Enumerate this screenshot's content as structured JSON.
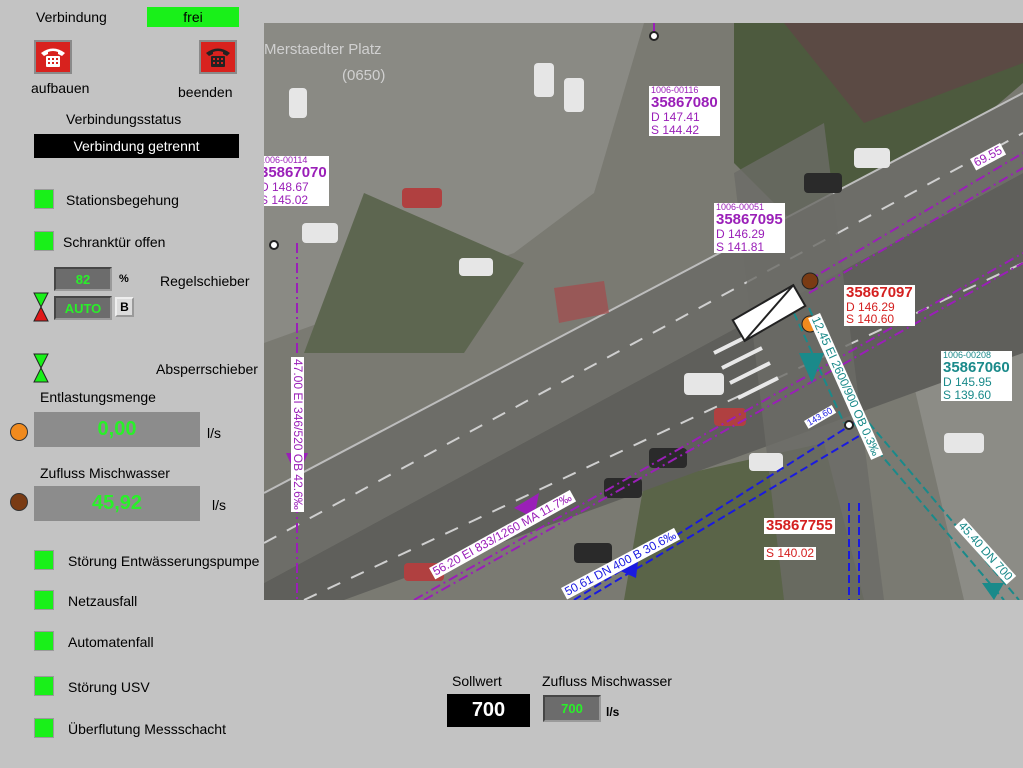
{
  "connection": {
    "label": "Verbindung",
    "state": "frei",
    "connect_label": "aufbauen",
    "disconnect_label": "beenden",
    "status_title": "Verbindungsstatus",
    "status_value": "Verbindung getrennt"
  },
  "indicators_top": [
    {
      "label": "Stationsbegehung",
      "color": "#19f019"
    },
    {
      "label": "Schranktür offen",
      "color": "#19f019"
    }
  ],
  "regelschieber": {
    "label": "Regelschieber",
    "value": "82",
    "unit": "%",
    "mode": "AUTO",
    "mode_button": "B"
  },
  "absperrschieber": {
    "label": "Absperrschieber"
  },
  "entlastung": {
    "label": "Entlastungsmenge",
    "value": "0,00",
    "unit": "l/s",
    "dot_color": "#f08a1e"
  },
  "zufluss": {
    "label": "Zufluss Mischwasser",
    "value": "45,92",
    "unit": "l/s",
    "dot_color": "#7a3b14"
  },
  "alarms": [
    {
      "label": "Störung Entwässerungspumpe",
      "color": "#19f019"
    },
    {
      "label": "Netzausfall",
      "color": "#19f019"
    },
    {
      "label": "Automatenfall",
      "color": "#19f019"
    },
    {
      "label": "Störung USV",
      "color": "#19f019"
    },
    {
      "label": "Überflutung Messschacht",
      "color": "#19f019"
    }
  ],
  "setpoint": {
    "label": "Sollwert",
    "value": "700"
  },
  "zufluss_setpoint": {
    "label": "Zufluss Mischwasser",
    "value": "700",
    "unit": "l/s"
  },
  "map": {
    "place": "Merstaedter Platz",
    "place_code": "(0650)",
    "nodes": [
      {
        "ref": "1006-00116",
        "id": "35867080",
        "d": "D 147.41",
        "s": "S 144.42",
        "color": "#9a1fb8"
      },
      {
        "ref": "1006-00114",
        "id": "35867070",
        "d": "D 148.67",
        "s": "S 145.02",
        "color": "#9a1fb8"
      },
      {
        "ref": "1006-00051",
        "id": "35867095",
        "d": "D 146.29",
        "s": "S 141.81",
        "color": "#9a1fb8"
      },
      {
        "ref": "",
        "id": "35867097",
        "d": "D 146.29",
        "s": "S 140.60",
        "color": "#d42020"
      },
      {
        "ref": "1006-00208",
        "id": "35867060",
        "d": "D 145.95",
        "s": "S 139.60",
        "color": "#1a8a8a"
      },
      {
        "ref": "",
        "id": "35867755",
        "d": "",
        "s": "S 140.02",
        "color": "#d42020"
      }
    ],
    "pipe_labels": [
      {
        "text": "47.00  EI 346/520  OB 42.6‰",
        "color": "#9a1fb8"
      },
      {
        "text": "56.20  EI 833/1260   MA 11.7‰",
        "color": "#9a1fb8"
      },
      {
        "text": "50.61  DN 400  B 30.6‰",
        "color": "#1a1ae0"
      },
      {
        "text": "12.45  EI 2600/900  OB 0.3‰",
        "color": "#1a8a8a"
      },
      {
        "text": "69.55",
        "color": "#9a1fb8"
      },
      {
        "text": "45.40  DN 700",
        "color": "#1a8a8a"
      },
      {
        "text": "143.60",
        "color": "#1a1ae0"
      }
    ]
  }
}
